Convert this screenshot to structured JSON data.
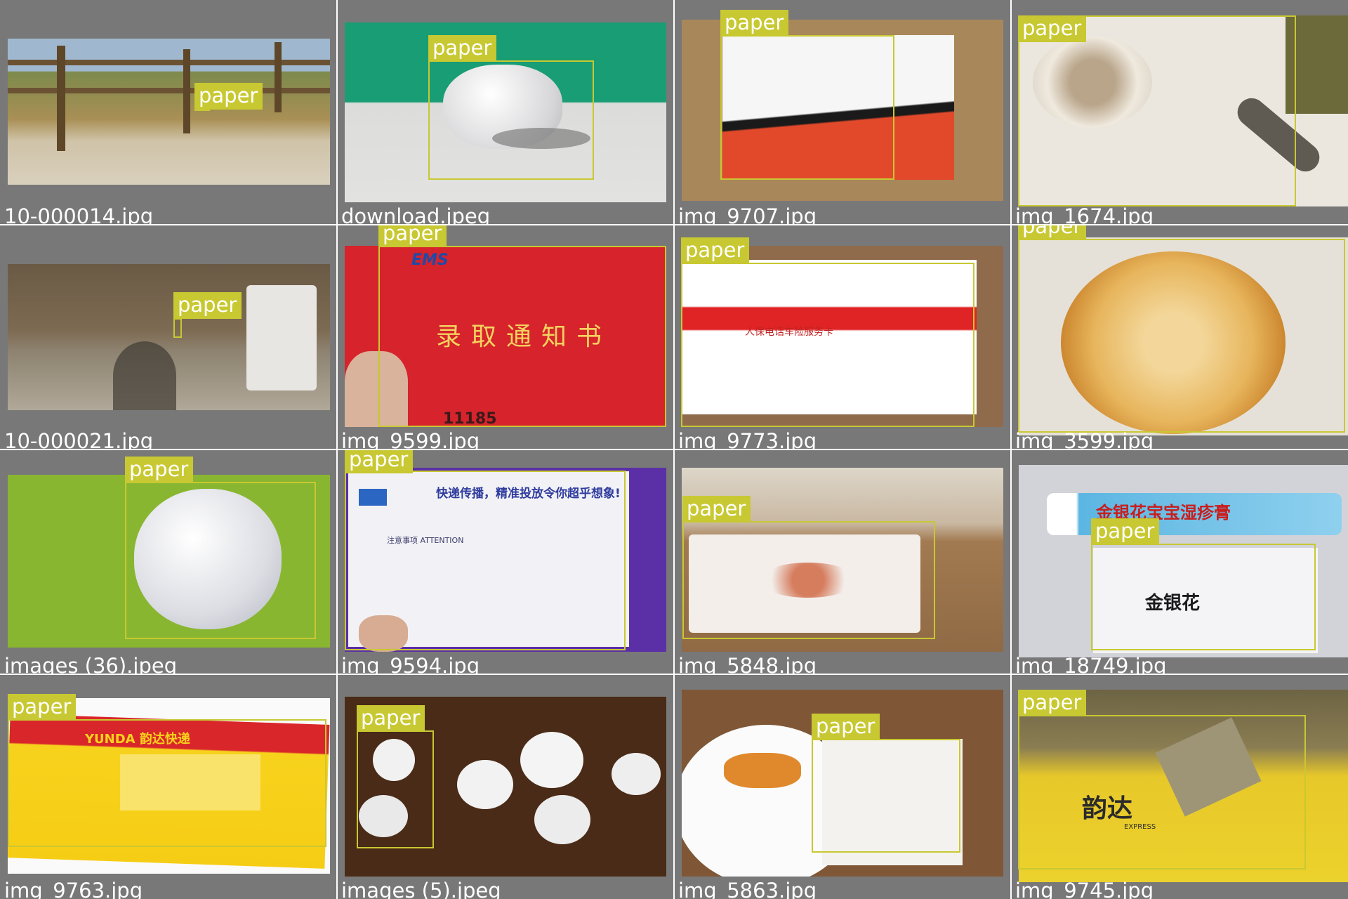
{
  "title": "",
  "colors": {
    "panel": "#787878",
    "box": "#c8c832",
    "text": "#ffffff"
  },
  "tiles": [
    {
      "file": "10-000014.jpg",
      "label": "paper"
    },
    {
      "file": "download.jpeg",
      "label": "paper"
    },
    {
      "file": "img_9707.jpg",
      "label": "paper"
    },
    {
      "file": "img_1674.jpg",
      "label": "paper"
    },
    {
      "file": "10-000021.jpg",
      "label": "paper"
    },
    {
      "file": "img_9599.jpg",
      "label": "paper",
      "scene_text": "录取通知书",
      "scene_text2": "EMS",
      "scene_text3": "11185"
    },
    {
      "file": "img_9773.jpg",
      "label": "paper",
      "scene_text": "人保电话车险服务卡"
    },
    {
      "file": "img_3599.jpg",
      "label": "paper"
    },
    {
      "file": "images (36).jpeg",
      "label": "paper"
    },
    {
      "file": "img_9594.jpg",
      "label": "paper",
      "scene_text": "快递传播，精准投放令你超乎想象!",
      "scene_text2": "注意事项 ATTENTION"
    },
    {
      "file": "img_5848.jpg",
      "label": "paper"
    },
    {
      "file": "img_18749.jpg",
      "label": "paper",
      "scene_text": "金银花宝宝湿疹膏",
      "scene_text2": "金银花"
    },
    {
      "file": "img_9763.jpg",
      "label": "paper",
      "scene_text": "YUNDA 韵达快递"
    },
    {
      "file": "images (5).jpeg",
      "label": "paper"
    },
    {
      "file": "img_5863.jpg",
      "label": "paper"
    },
    {
      "file": "img_9745.jpg",
      "label": "paper",
      "scene_text": "韵达",
      "scene_text2": "EXPRESS"
    }
  ]
}
